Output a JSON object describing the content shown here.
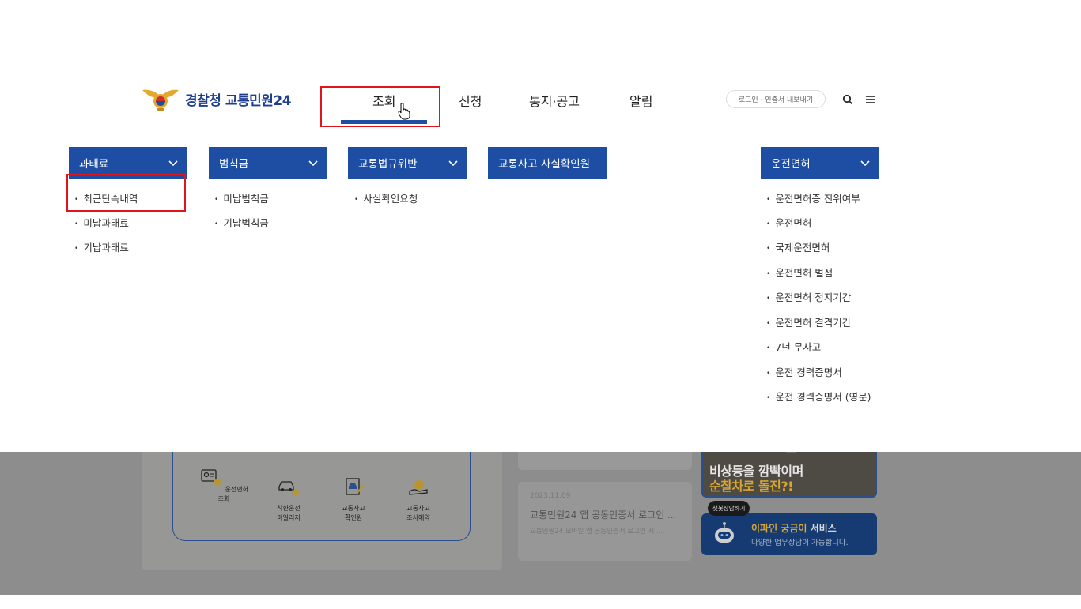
{
  "header": {
    "logo_text": "경찰청 교통민원24",
    "nav": [
      "조회",
      "신청",
      "통지·공고",
      "알림"
    ],
    "login_label": "로그인 · 인증서 내보내기",
    "icons": [
      "search-icon",
      "menu-icon"
    ]
  },
  "menu": {
    "categories": [
      {
        "label": "과태료",
        "items": [
          "최근단속내역",
          "미납과태료",
          "기납과태료"
        ]
      },
      {
        "label": "범칙금",
        "items": [
          "미납범칙금",
          "기납범칙금"
        ]
      },
      {
        "label": "교통법규위반",
        "items": [
          "사실확인요청"
        ]
      },
      {
        "label": "교통사고 사실확인원",
        "items": []
      },
      {
        "label": "운전면허",
        "items": [
          "운전면허증 진위여부",
          "운전면허",
          "국제운전면허",
          "운전면허 벌점",
          "운전면허 정지기간",
          "운전면허 결격기간",
          "7년 무사고",
          "운전 경력증명서",
          "운전 경력증명서 (영문)"
        ]
      }
    ]
  },
  "background": {
    "services": [
      {
        "label": "운전면허조회",
        "icon": "license-icon"
      },
      {
        "label": "착한운전\n마일리지",
        "icon": "car-coin-icon"
      },
      {
        "label": "교통사고\n확인원",
        "icon": "accident-doc-icon"
      },
      {
        "label": "교통사고\n조사예약",
        "icon": "reservation-icon"
      }
    ],
    "news": {
      "date": "2023.11.09",
      "title": "교통민원24 앱 공동인증서 로그인 ...",
      "desc": "교통민원24 모바일 앱 공동인증서 로그인 서 ..."
    },
    "banner": {
      "line1": "비상등을 깜빡이며",
      "line2": "순찰차로 돌진?!"
    },
    "chat": {
      "bubble": "챗봇상담하기",
      "title_highlight": "이파인 궁금이",
      "title_rest": " 서비스",
      "subtitle": "다양한 업무상담이 가능합니다."
    }
  },
  "colors": {
    "brand_blue": "#1e4ea3",
    "highlight_red": "#e0141b",
    "dim_overlay": "#8d8d8d"
  }
}
